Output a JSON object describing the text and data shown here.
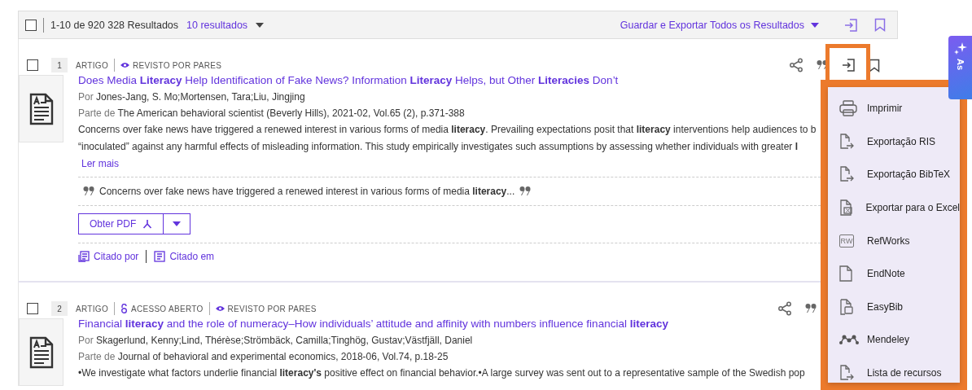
{
  "header": {
    "checked": false,
    "count": "1-10 de 920 328 Resultados",
    "per_page": "10 resultados",
    "export_all": "Guardar e Exportar Todos os Resultados"
  },
  "results": [
    {
      "checked": false,
      "number": "1",
      "type": "ARTIGO",
      "badges": [
        {
          "kind": "peer_reviewed",
          "label": "REVISTO POR PARES"
        }
      ],
      "title": "Does Media **Literacy** Help Identification of Fake News? Information **Literacy** Helps, but Other **Literacies** Don’t",
      "by_label": "Por",
      "authors": "Jones-Jang, S. Mo;Mortensen, Tara;Liu, Jingjing",
      "part_label": "Parte de",
      "source": "The American behavioral scientist (Beverly Hills), 2021-02, Vol.65 (2), p.371-388",
      "description_lines": [
        "Concerns over fake news have triggered a renewed interest in various forms of media **literacy**. Prevailing expectations posit that **literacy** interventions help audiences to b",
        "“inoculated” against any harmful effects of misleading information. This study empirically investigates such assumptions by assessing whether individuals with greater **l**"
      ],
      "read_more": "Ler mais",
      "snippet": "Concerns over fake news have triggered a renewed interest in various forms of media **literacy**...",
      "pdf_button": "Obter PDF",
      "cited_by": "Citado por",
      "cited_in": "Citado em",
      "export_highlighted": true
    },
    {
      "checked": false,
      "number": "2",
      "type": "ARTIGO",
      "badges": [
        {
          "kind": "open_access",
          "label": "ACESSO ABERTO"
        },
        {
          "kind": "peer_reviewed",
          "label": "REVISTO POR PARES"
        }
      ],
      "title": "Financial **literacy** and the role of numeracy–How individuals’ attitude and affinity with numbers influence financial **literacy**",
      "by_label": "Por",
      "authors": "Skagerlund, Kenny;Lind, Thérèse;Strömbäck, Camilla;Tinghög, Gustav;Västfjäll, Daniel",
      "part_label": "Parte de",
      "source": "Journal of behavioral and experimental economics, 2018-06, Vol.74, p.18-25",
      "description_lines": [
        "•We investigate what factors underlie financial **literacy's** positive effect on financial behavior.•A large survey was sent out to a representative sample of the Swedish pop"
      ],
      "export_highlighted": false
    }
  ],
  "export_menu": {
    "highlighted": true,
    "items": [
      {
        "kind": "print",
        "label": "Imprimir"
      },
      {
        "kind": "file_export",
        "label": "Exportação RIS"
      },
      {
        "kind": "file_export",
        "label": "Exportação BibTeX"
      },
      {
        "kind": "excel",
        "label": "Exportar para o Excel"
      },
      {
        "kind": "refworks",
        "icon_text": "RW",
        "label": "RefWorks"
      },
      {
        "kind": "file",
        "label": "EndNote"
      },
      {
        "kind": "easybib",
        "label": "EasyBib"
      },
      {
        "kind": "mendeley",
        "label": "Mendeley"
      },
      {
        "kind": "file_export",
        "label": "Lista de recursos"
      }
    ]
  },
  "side_tab": {
    "label": "As"
  }
}
